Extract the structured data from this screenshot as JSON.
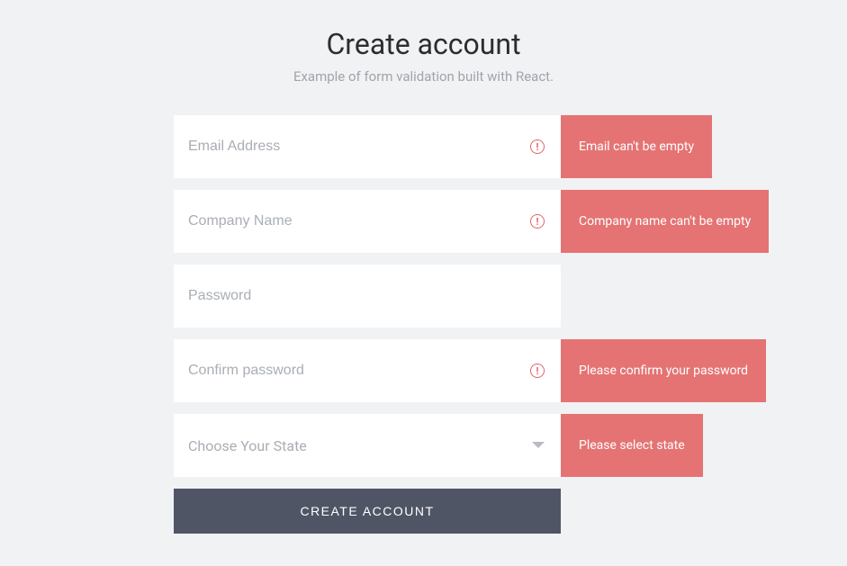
{
  "header": {
    "title": "Create account",
    "subtitle": "Example of form validation built with React."
  },
  "form": {
    "email": {
      "placeholder": "Email Address",
      "value": "",
      "error": "Email can't be empty"
    },
    "company": {
      "placeholder": "Company Name",
      "value": "",
      "error": "Company name can't be empty"
    },
    "password": {
      "placeholder": "Password",
      "value": ""
    },
    "confirmPassword": {
      "placeholder": "Confirm password",
      "value": "",
      "error": "Please confirm your password"
    },
    "state": {
      "placeholder": "Choose Your State",
      "value": "",
      "error": "Please select state"
    },
    "submit": {
      "label": "CREATE ACCOUNT"
    }
  }
}
